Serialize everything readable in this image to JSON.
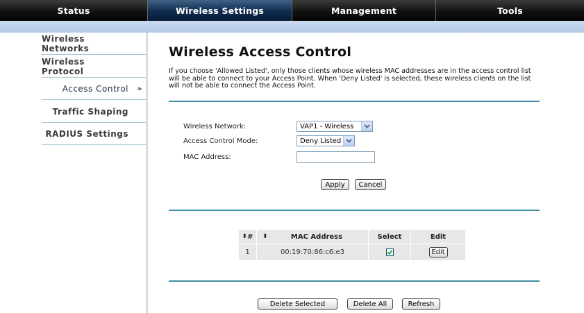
{
  "nav": {
    "tabs": [
      {
        "label": "Status"
      },
      {
        "label": "Wireless Settings"
      },
      {
        "label": "Management"
      },
      {
        "label": "Tools"
      }
    ],
    "active_tab": "Wireless Settings"
  },
  "sidebar": {
    "items": [
      {
        "label": "Wireless Networks"
      },
      {
        "label": "Wireless Protocol"
      },
      {
        "label": "Access Control"
      },
      {
        "label": "Traffic Shaping"
      },
      {
        "label": "RADIUS Settings"
      }
    ],
    "active_item": "Access Control",
    "active_marker": "»"
  },
  "page": {
    "title": "Wireless Access Control",
    "description": "If you choose 'Allowed Listed', only those clients whose wireless MAC addresses are in the access control list will be able to connect to your Access Point. When 'Deny Listed' is selected, these wireless clients on the list will not be able to connect the Access Point."
  },
  "form": {
    "network_label": "Wireless Network:",
    "network_value": "VAP1 - Wireless",
    "mode_label": "Access Control Mode:",
    "mode_value": "Deny Listed",
    "mac_label": "MAC Address:",
    "mac_value": "",
    "apply_label": "Apply",
    "cancel_label": "Cancel"
  },
  "table": {
    "headers": {
      "index": "#",
      "mac": "MAC Address",
      "select": "Select",
      "edit": "Edit"
    },
    "sort_icon": "⬍",
    "rows": [
      {
        "index": "1",
        "mac": "00:19:70:86:c6:e3",
        "selected": true,
        "edit_label": "Edit"
      }
    ]
  },
  "actions": {
    "delete_selected": "Delete Selected",
    "delete_all": "Delete All",
    "refresh": "Refresh"
  },
  "colors": {
    "active_tab": "#0f2b4e",
    "subbar": "#c0d4ec",
    "rule": "#3f8fa2"
  }
}
